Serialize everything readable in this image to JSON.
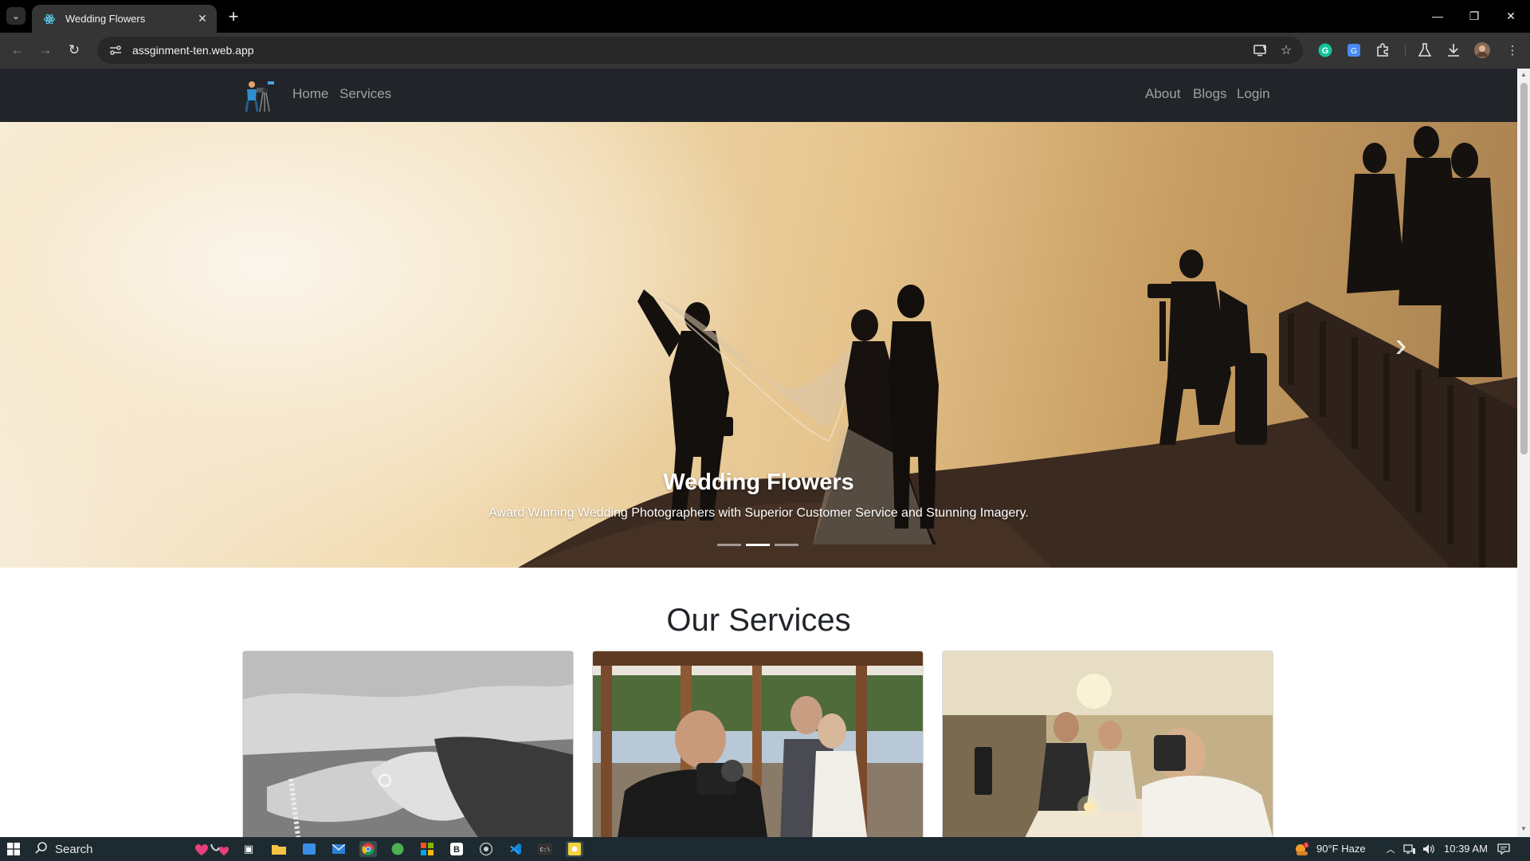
{
  "browser": {
    "tab_title": "Wedding Flowers",
    "url": "assginment-ten.web.app"
  },
  "site": {
    "nav_left": [
      "Home",
      "Services"
    ],
    "nav_right": [
      "About",
      "Blogs",
      "Login"
    ],
    "hero": {
      "title": "Wedding Flowers",
      "subtitle": "Award Winning Wedding Photographers with Superior Customer Service and Stunning Imagery.",
      "slide_count": 3,
      "active_slide": 2
    },
    "services_heading": "Our Services"
  },
  "taskbar": {
    "search_label": "Search",
    "weather": "90°F  Haze",
    "time": "10:39 AM"
  },
  "colors": {
    "navbar_bg": "#212529",
    "chrome_bg": "#353535",
    "taskbar_bg": "#1d2a30"
  }
}
